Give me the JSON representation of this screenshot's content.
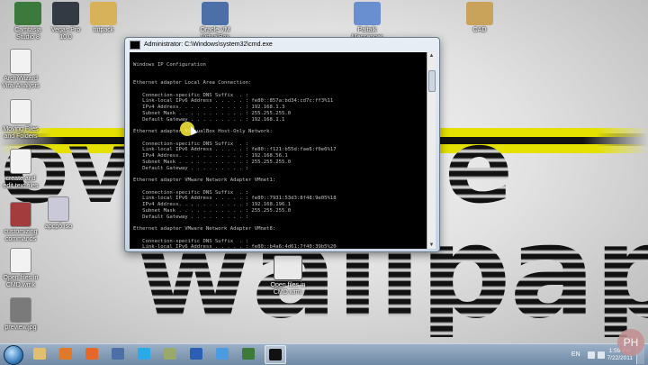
{
  "desktop": {
    "icons_top": [
      {
        "label": "Camtasia Studio 8",
        "name": "camtasia-icon",
        "color": "#3c7a3c"
      },
      {
        "label": "Vegas Pro 10.0",
        "name": "vegas-pro-icon",
        "color": "#333a44"
      },
      {
        "label": "tutpack",
        "name": "tutpack-folder-icon",
        "color": "#d8b25a"
      },
      {
        "label": "Oracle VM VirtualBox",
        "name": "virtualbox-icon",
        "color": "#4c6fa8"
      },
      {
        "label": "Paltalk Messenger",
        "name": "paltalk-icon",
        "color": "#6a8fd0"
      },
      {
        "label": "CAD",
        "name": "cad-folder-icon",
        "color": "#c9a35a"
      }
    ],
    "icons_left": [
      {
        "label": "ArchiWizard Viral Analysis",
        "name": "document-icon",
        "color": "#f2f2f2"
      },
      {
        "label": "Moving Files and Folders",
        "name": "document-icon",
        "color": "#f2f2f2"
      },
      {
        "label": "create and edit text files",
        "name": "document-icon",
        "color": "#f2f2f2"
      },
      {
        "label": "customizing commands",
        "name": "media-file-icon",
        "color": "#a33c3c"
      },
      {
        "label": "apcp5.iso",
        "name": "disc-image-icon",
        "color": "#c9c9d9"
      },
      {
        "label": "Open files in CMD.wmk",
        "name": "document-icon",
        "color": "#f2f2f2"
      },
      {
        "label": "preview.jpg",
        "name": "image-file-icon",
        "color": "#7a7a7a"
      }
    ],
    "shortcut_mid": {
      "label": "Open files in CMD.wmv",
      "name": "video-file-icon"
    },
    "wallpaper": {
      "line1": "overrride",
      "line2": "wallpaper"
    }
  },
  "cmd": {
    "title": "Administrator: C:\\Windows\\system32\\cmd.exe",
    "lines": [
      "",
      "Windows IP Configuration",
      "",
      "",
      "Ethernet adapter Local Area Connection:",
      "",
      "   Connection-specific DNS Suffix  . :",
      "   Link-local IPv6 Address . . . . . : fe80::857a:bd34:cd7c:ff3%11",
      "   IPv4 Address. . . . . . . . . . . : 192.168.1.3",
      "   Subnet Mask . . . . . . . . . . . : 255.255.255.0",
      "   Default Gateway . . . . . . . . . : 192.168.1.1",
      "",
      "Ethernet adapter VirtualBox Host-Only Network:",
      "",
      "   Connection-specific DNS Suffix  . :",
      "   Link-local IPv6 Address . . . . . : fe80::f121:b55d:fae6:f0e6%17",
      "   IPv4 Address. . . . . . . . . . . : 192.168.56.1",
      "   Subnet Mask . . . . . . . . . . . : 255.255.255.0",
      "   Default Gateway . . . . . . . . . :",
      "",
      "Ethernet adapter VMware Network Adapter VMnet1:",
      "",
      "   Connection-specific DNS Suffix  . :",
      "   Link-local IPv6 Address . . . . . : fe80::7931:53d3:8f48:9e05%18",
      "   IPv4 Address. . . . . . . . . . . : 192.168.196.1",
      "   Subnet Mask . . . . . . . . . . . : 255.255.255.0",
      "   Default Gateway . . . . . . . . . :",
      "",
      "Ethernet adapter VMware Network Adapter VMnet8:",
      "",
      "   Connection-specific DNS Suffix  . :",
      "   Link-local IPv6 Address . . . . . : fe80::b4a6:4d61:7f40:39b5%20"
    ]
  },
  "taskbar": {
    "buttons": [
      {
        "name": "explorer-taskbar-icon",
        "color": "#e0c070"
      },
      {
        "name": "media-player-taskbar-icon",
        "color": "#e07a2a"
      },
      {
        "name": "firefox-taskbar-icon",
        "color": "#e5682a"
      },
      {
        "name": "virtualbox-taskbar-icon",
        "color": "#4c6fa8"
      },
      {
        "name": "skype-taskbar-icon",
        "color": "#2aa9e8"
      },
      {
        "name": "tools-taskbar-icon",
        "color": "#9aa86a"
      },
      {
        "name": "word-taskbar-icon",
        "color": "#2b5fb4"
      },
      {
        "name": "paltalk-taskbar-icon",
        "color": "#4b9be0"
      },
      {
        "name": "camtasia-taskbar-icon",
        "color": "#3c7a3c"
      },
      {
        "name": "cmd-taskbar-icon",
        "color": "#111111",
        "active": true
      }
    ],
    "language": "EN",
    "clock_time": "1:59 PM",
    "clock_date": "7/22/2011"
  },
  "watermark": "PH"
}
